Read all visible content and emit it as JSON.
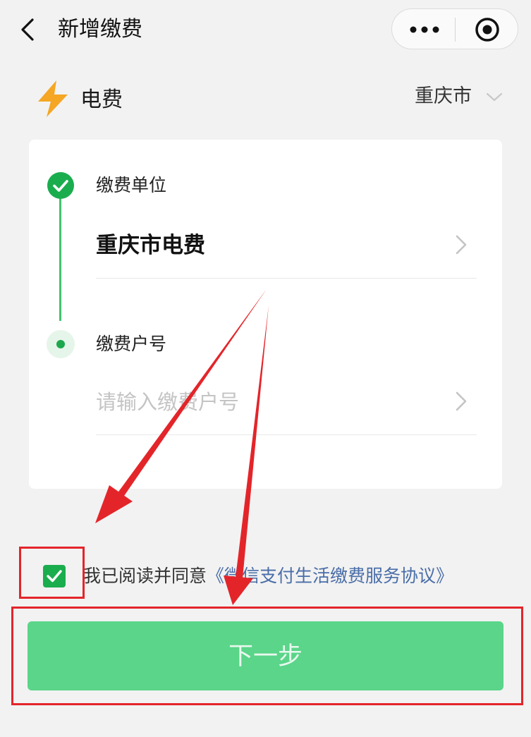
{
  "header": {
    "title": "新增缴费"
  },
  "bill": {
    "type": "电费",
    "city": "重庆市"
  },
  "form": {
    "payee_label": "缴费单位",
    "payee_value": "重庆市电费",
    "account_label": "缴费户号",
    "account_placeholder": "请输入缴费户号",
    "account_value": ""
  },
  "agreement": {
    "checked": true,
    "prefix": "我已阅读并同意",
    "link": "《微信支付生活缴费服务协议》"
  },
  "actions": {
    "next_label": "下一步"
  },
  "colors": {
    "brand_green": "#1aad4e",
    "button_disabled": "#5ad589",
    "bolt_orange": "#f5a623",
    "link_blue": "#4a6ea8",
    "annotation_red": "#e3252a"
  },
  "icons": {
    "back": "chevron-left-icon",
    "more": "more-dots-icon",
    "close": "target-circle-icon",
    "bill_type": "lightning-bolt-icon",
    "city": "chevron-down-icon",
    "step_done": "check-circle-icon",
    "row": "chevron-right-icon",
    "checkbox": "checkmark-icon"
  }
}
